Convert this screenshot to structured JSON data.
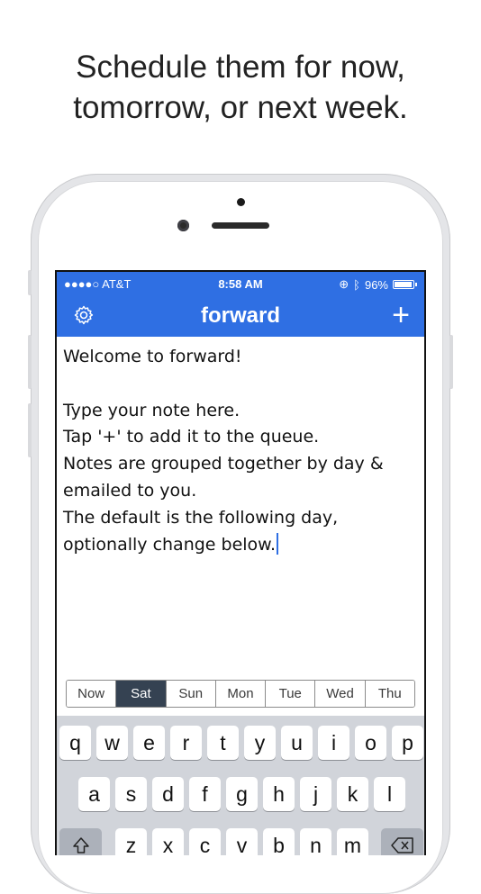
{
  "headline": {
    "line1": "Schedule them for now,",
    "line2": "tomorrow, or next week."
  },
  "status": {
    "carrier": "●●●●○ AT&T",
    "time": "8:58 AM",
    "battery": "96%"
  },
  "nav": {
    "title": "forward",
    "add": "+"
  },
  "note_lines": [
    "Welcome to forward!",
    "",
    "Type your note here.",
    "Tap '+' to add it to the queue.",
    "Notes are grouped together by day &",
    "emailed to you.",
    "The default is the following day,",
    "optionally change below."
  ],
  "days": [
    "Now",
    "Sat",
    "Sun",
    "Mon",
    "Tue",
    "Wed",
    "Thu"
  ],
  "selected_day": "Sat",
  "keyboard": {
    "row1": [
      "q",
      "w",
      "e",
      "r",
      "t",
      "y",
      "u",
      "i",
      "o",
      "p"
    ],
    "row2": [
      "a",
      "s",
      "d",
      "f",
      "g",
      "h",
      "j",
      "k",
      "l"
    ],
    "row3": [
      "z",
      "x",
      "c",
      "v",
      "b",
      "n",
      "m"
    ],
    "shift_icon": "shift-icon",
    "delete_icon": "backspace-icon"
  },
  "colors": {
    "accent": "#2f6fe3",
    "selected_day": "#354252"
  }
}
